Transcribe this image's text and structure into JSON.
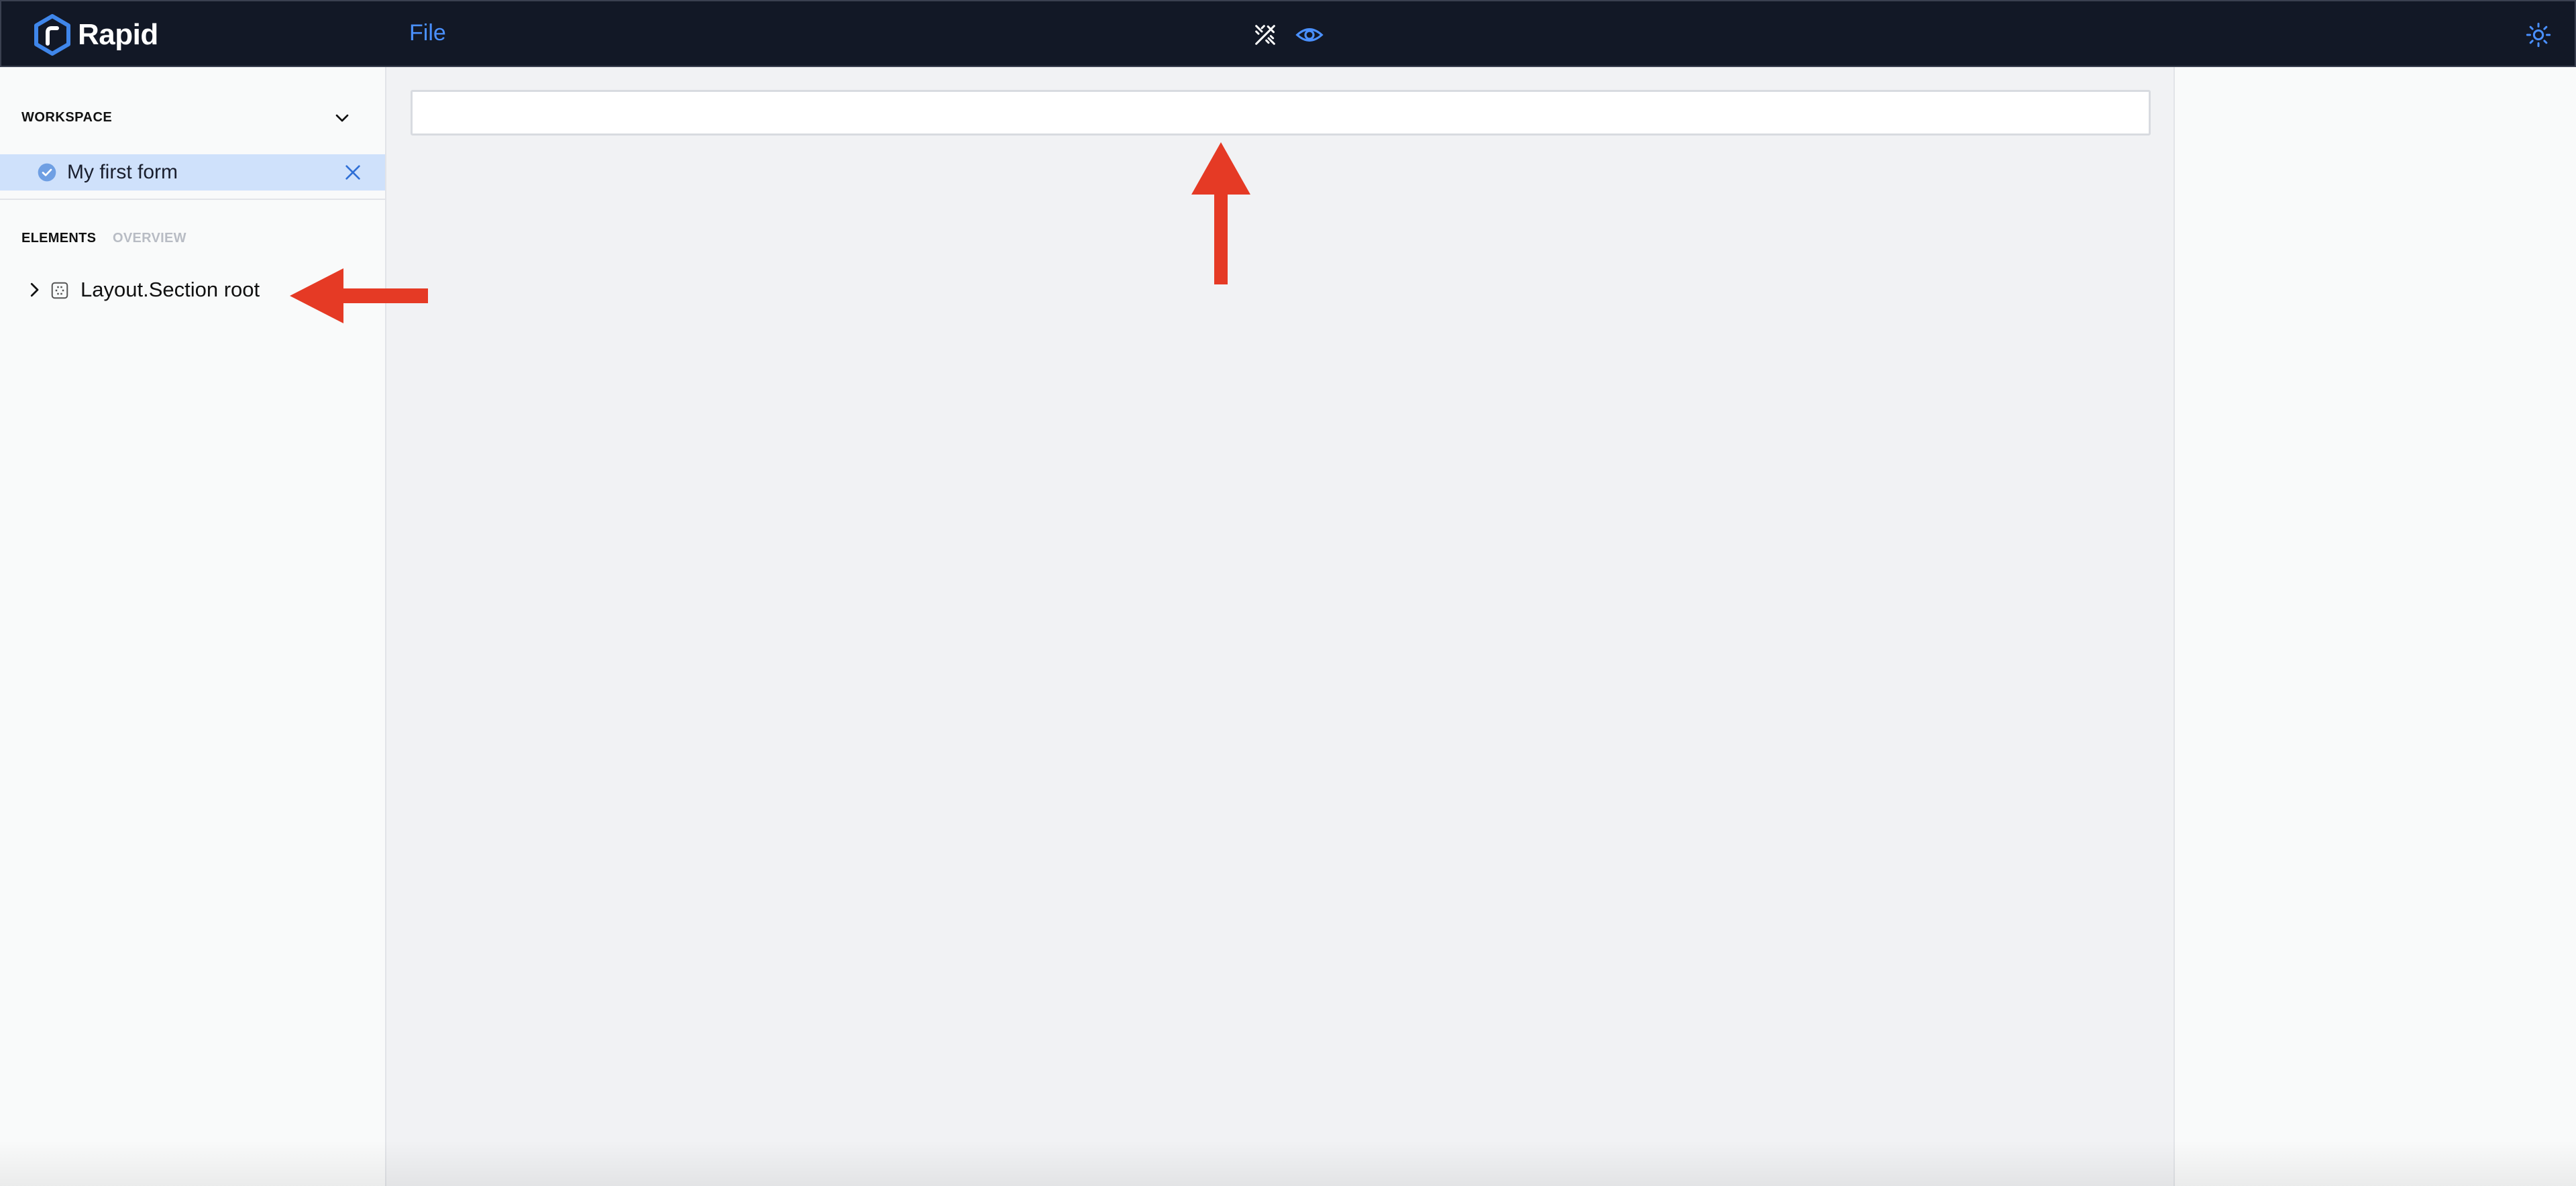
{
  "app": {
    "name": "Rapid"
  },
  "menu": {
    "file_label": "File"
  },
  "toolbar": {
    "edit_mode_icon": "edit-design-icon",
    "preview_icon": "eye-icon",
    "theme_icon": "sun-icon"
  },
  "workspace": {
    "title": "WORKSPACE",
    "items": [
      {
        "label": "My first form",
        "status_icon": "check-circle-icon"
      }
    ]
  },
  "panel_tabs": [
    {
      "label": "ELEMENTS"
    },
    {
      "label": "OVERVIEW"
    }
  ],
  "tree": [
    {
      "label": "Layout.Section root",
      "icon": "section-icon"
    }
  ],
  "colors": {
    "topbar_bg": "#121826",
    "accent": "#4a90ff",
    "selected_bg": "#cfe1fb",
    "annotation_arrow": "#e53a25"
  }
}
